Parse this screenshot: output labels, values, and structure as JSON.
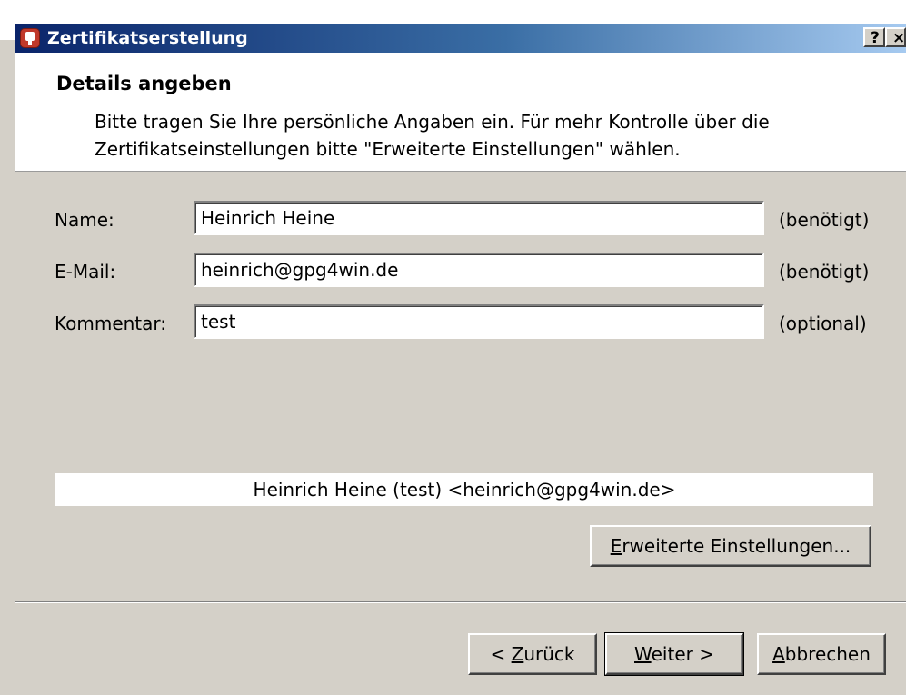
{
  "window": {
    "title": "Zertifikatserstellung",
    "help_label": "?",
    "close_label": "×"
  },
  "header": {
    "title": "Details angeben",
    "description": "Bitte tragen Sie Ihre persönliche Angaben ein. Für mehr Kontrolle über die Zertifikatseinstellungen bitte \"Erweiterte Einstellungen\" wählen."
  },
  "form": {
    "name": {
      "label": "Name:",
      "value": "Heinrich Heine",
      "hint": "(benötigt)"
    },
    "email": {
      "label": "E-Mail:",
      "value": "heinrich@gpg4win.de",
      "hint": "(benötigt)"
    },
    "comment": {
      "label": "Kommentar:",
      "value": "test",
      "hint": "(optional)"
    }
  },
  "preview": "Heinrich Heine (test) <heinrich@gpg4win.de>",
  "buttons": {
    "advanced": {
      "mnemonic": "E",
      "rest": "rweiterte Einstellungen..."
    },
    "back": {
      "prefix": "< ",
      "mnemonic": "Z",
      "rest": "urück"
    },
    "next": {
      "mnemonic": "W",
      "rest": "eiter >"
    },
    "cancel": {
      "mnemonic": "A",
      "rest": "bbrechen"
    }
  },
  "icons": {
    "app": "certificate-app-icon",
    "help": "help-icon",
    "close": "close-icon"
  },
  "colors": {
    "titlebar_start": "#0a246a",
    "titlebar_end": "#a6caf0",
    "dialog_bg": "#d4d0c8"
  }
}
